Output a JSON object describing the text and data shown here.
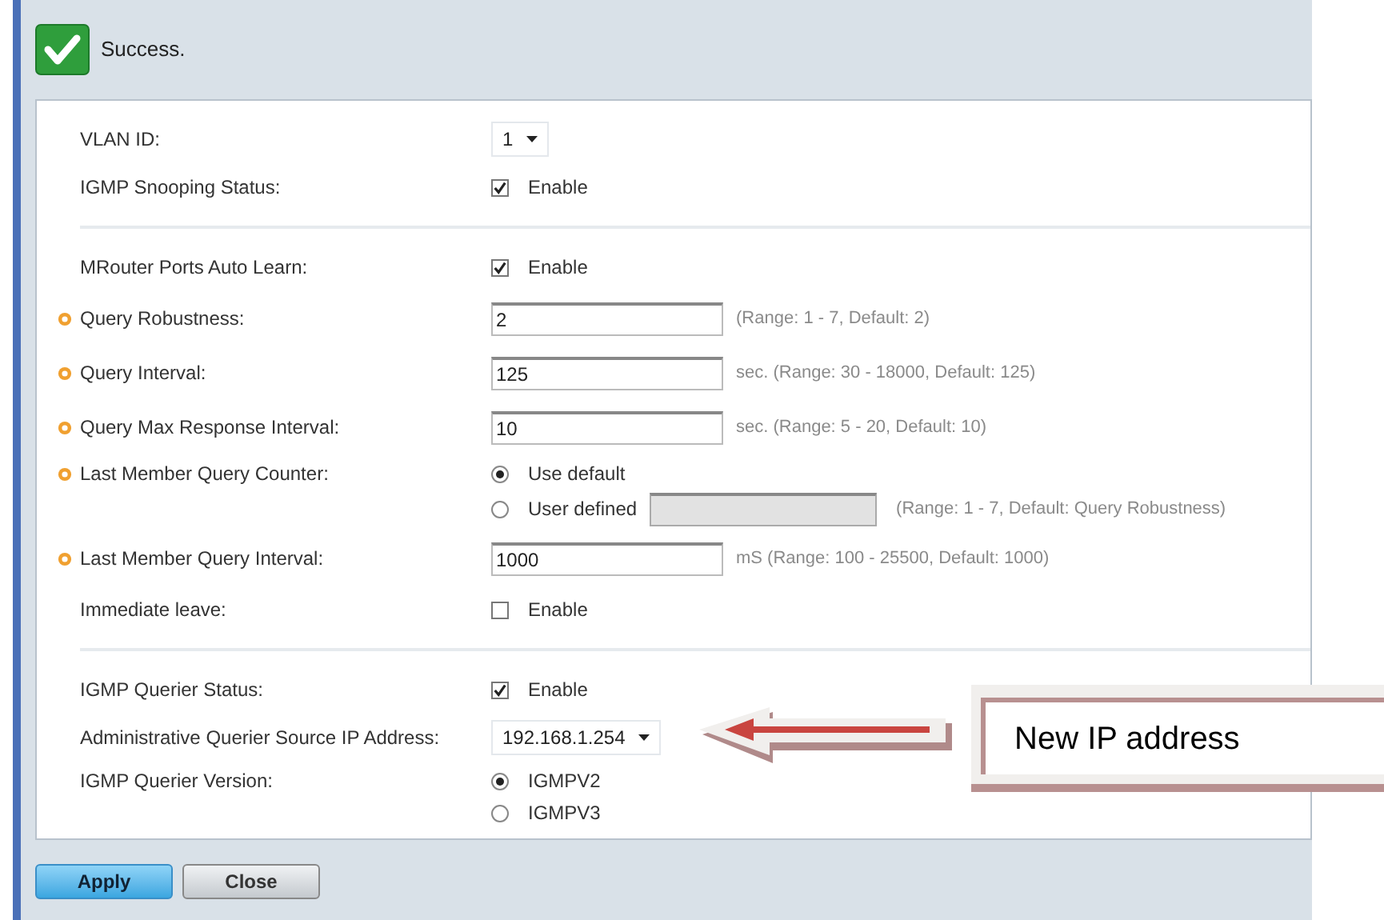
{
  "status": {
    "message": "Success."
  },
  "sections": [
    {
      "rows": [
        {
          "kind": "select",
          "label": "VLAN ID:",
          "required": false,
          "value": "1"
        },
        {
          "kind": "checkbox",
          "label": "IGMP Snooping Status:",
          "required": false,
          "option": "Enable",
          "checked": true
        }
      ]
    },
    {
      "rows": [
        {
          "kind": "checkbox",
          "label": "MRouter Ports Auto Learn:",
          "required": false,
          "option": "Enable",
          "checked": true
        },
        {
          "kind": "text",
          "label": "Query Robustness:",
          "required": true,
          "value": "2",
          "hint": "(Range: 1 - 7, Default: 2)"
        },
        {
          "kind": "text",
          "label": "Query Interval:",
          "required": true,
          "value": "125",
          "hint": "sec. (Range: 30 - 18000, Default: 125)"
        },
        {
          "kind": "text",
          "label": "Query Max Response Interval:",
          "required": true,
          "value": "10",
          "hint": "sec. (Range: 5 - 20, Default: 10)"
        },
        {
          "kind": "radio",
          "label": "Last Member Query Counter:",
          "required": true,
          "options": [
            {
              "label": "Use default",
              "selected": true
            },
            {
              "label": "User defined",
              "selected": false,
              "field": {
                "disabled": true
              },
              "hint": "(Range: 1 - 7, Default: Query Robustness)"
            }
          ]
        },
        {
          "kind": "text",
          "label": "Last Member Query Interval:",
          "required": true,
          "value": "1000",
          "hint": "mS (Range: 100 - 25500, Default: 1000)"
        },
        {
          "kind": "checkbox",
          "label": "Immediate leave:",
          "required": false,
          "option": "Enable",
          "checked": false
        }
      ]
    },
    {
      "rows": [
        {
          "kind": "checkbox",
          "label": "IGMP Querier Status:",
          "required": false,
          "option": "Enable",
          "checked": true
        },
        {
          "kind": "select",
          "label": "Administrative Querier Source IP Address:",
          "required": false,
          "value": "192.168.1.254"
        },
        {
          "kind": "radio",
          "label": "IGMP Querier Version:",
          "required": false,
          "options": [
            {
              "label": "IGMPV2",
              "selected": true
            },
            {
              "label": "IGMPV3",
              "selected": false
            }
          ]
        }
      ]
    }
  ],
  "buttons": [
    {
      "label": "Apply",
      "primary": true
    },
    {
      "label": "Close",
      "primary": false
    }
  ],
  "annotation": {
    "text": "New IP address"
  }
}
